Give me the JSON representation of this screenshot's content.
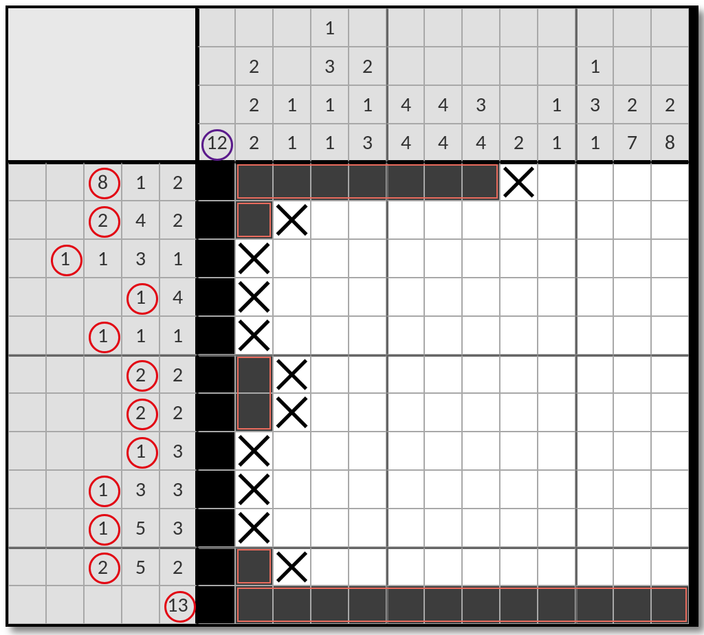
{
  "puzzle": {
    "gridCols": 13,
    "gridRows": 12,
    "rowClueCols": 5,
    "colClueRows": 4,
    "colClues": [
      [
        "",
        "",
        "",
        "12"
      ],
      [
        "",
        "2",
        "2",
        "2"
      ],
      [
        "",
        "",
        "1",
        "1"
      ],
      [
        "1",
        "3",
        "1",
        "1"
      ],
      [
        "",
        "2",
        "1",
        "3"
      ],
      [
        "",
        "",
        "4",
        "4"
      ],
      [
        "",
        "",
        "4",
        "4"
      ],
      [
        "",
        "",
        "3",
        "4"
      ],
      [
        "",
        "",
        "",
        "2"
      ],
      [
        "",
        "",
        "1",
        "1"
      ],
      [
        "",
        "1",
        "3",
        "1"
      ],
      [
        "",
        "",
        "2",
        "7"
      ],
      [
        "",
        "",
        "2",
        "8"
      ]
    ],
    "rowClues": [
      [
        "",
        "",
        "8",
        "1",
        "2"
      ],
      [
        "",
        "",
        "2",
        "4",
        "2"
      ],
      [
        "",
        "1",
        "1",
        "3",
        "1"
      ],
      [
        "",
        "",
        "",
        "1",
        "4"
      ],
      [
        "",
        "",
        "1",
        "1",
        "1"
      ],
      [
        "",
        "",
        "",
        "2",
        "2"
      ],
      [
        "",
        "",
        "",
        "2",
        "2"
      ],
      [
        "",
        "",
        "",
        "1",
        "3"
      ],
      [
        "",
        "",
        "1",
        "3",
        "3"
      ],
      [
        "",
        "",
        "1",
        "5",
        "3"
      ],
      [
        "",
        "",
        "2",
        "5",
        "2"
      ],
      [
        "",
        "",
        "",
        "",
        "13"
      ]
    ],
    "cells": [
      [
        "F",
        "F",
        "F",
        "F",
        "F",
        "F",
        "F",
        "F",
        "X",
        "",
        "",
        "",
        ""
      ],
      [
        "F",
        "F",
        "X",
        "",
        "",
        "",
        "",
        "",
        "",
        "",
        "",
        "",
        ""
      ],
      [
        "F",
        "X",
        "",
        "",
        "",
        "",
        "",
        "",
        "",
        "",
        "",
        "",
        ""
      ],
      [
        "F",
        "X",
        "",
        "",
        "",
        "",
        "",
        "",
        "",
        "",
        "",
        "",
        ""
      ],
      [
        "F",
        "X",
        "",
        "",
        "",
        "",
        "",
        "",
        "",
        "",
        "",
        "",
        ""
      ],
      [
        "F",
        "F",
        "X",
        "",
        "",
        "",
        "",
        "",
        "",
        "",
        "",
        "",
        ""
      ],
      [
        "F",
        "F",
        "X",
        "",
        "",
        "",
        "",
        "",
        "",
        "",
        "",
        "",
        ""
      ],
      [
        "F",
        "X",
        "",
        "",
        "",
        "",
        "",
        "",
        "",
        "",
        "",
        "",
        ""
      ],
      [
        "F",
        "X",
        "",
        "",
        "",
        "",
        "",
        "",
        "",
        "",
        "",
        "",
        ""
      ],
      [
        "F",
        "X",
        "",
        "",
        "",
        "",
        "",
        "",
        "",
        "",
        "",
        "",
        ""
      ],
      [
        "F",
        "F",
        "X",
        "",
        "",
        "",
        "",
        "",
        "",
        "",
        "",
        "",
        ""
      ],
      [
        "F",
        "F",
        "F",
        "F",
        "F",
        "F",
        "F",
        "F",
        "F",
        "F",
        "F",
        "F",
        "F"
      ]
    ],
    "cellHighlights": [
      {
        "row": 0,
        "col": 1,
        "w": 7,
        "h": 1
      },
      {
        "row": 1,
        "col": 1,
        "w": 1,
        "h": 1
      },
      {
        "row": 5,
        "col": 1,
        "w": 1,
        "h": 2
      },
      {
        "row": 10,
        "col": 1,
        "w": 1,
        "h": 1
      },
      {
        "row": 11,
        "col": 1,
        "w": 12,
        "h": 1
      }
    ],
    "circledColClue": {
      "col": 0,
      "rowInCol": 3,
      "color": "purple"
    },
    "circledRowClues": [
      {
        "row": 0,
        "colInRow": 2
      },
      {
        "row": 1,
        "colInRow": 2
      },
      {
        "row": 2,
        "colInRow": 1
      },
      {
        "row": 3,
        "colInRow": 3
      },
      {
        "row": 4,
        "colInRow": 2
      },
      {
        "row": 5,
        "colInRow": 3
      },
      {
        "row": 6,
        "colInRow": 3
      },
      {
        "row": 7,
        "colInRow": 3
      },
      {
        "row": 8,
        "colInRow": 2
      },
      {
        "row": 9,
        "colInRow": 2
      },
      {
        "row": 10,
        "colInRow": 2
      },
      {
        "row": 11,
        "colInRow": 4
      }
    ]
  }
}
